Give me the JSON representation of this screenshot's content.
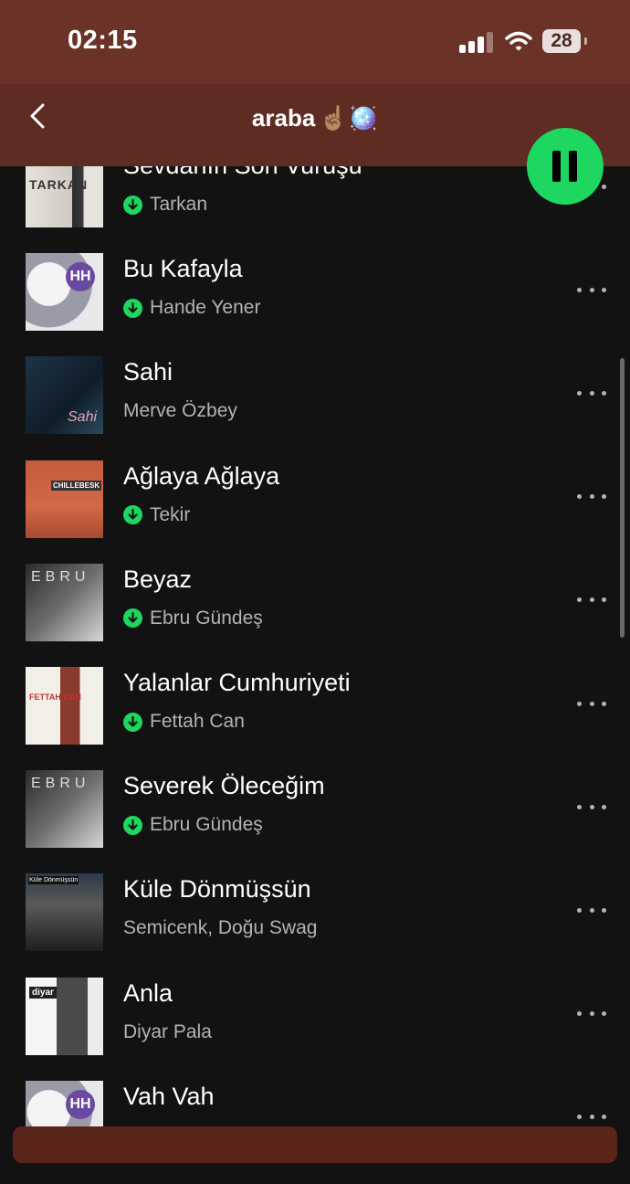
{
  "status": {
    "time": "02:15",
    "battery": "28"
  },
  "header": {
    "title": "araba",
    "emoji": "☝🏽🪩"
  },
  "colors": {
    "accent": "#1ed760",
    "header_bg": "#5e2c22",
    "bg": "#121212"
  },
  "tracks": [
    {
      "title": "Sevdanın Son Vuruşu",
      "artist": "Tarkan",
      "downloaded": true,
      "cover_text": "TARKAN"
    },
    {
      "title": "Bu Kafayla",
      "artist": "Hande Yener",
      "downloaded": true,
      "cover_text": "HH"
    },
    {
      "title": "Sahi",
      "artist": "Merve Özbey",
      "downloaded": false,
      "cover_text": "Sahi"
    },
    {
      "title": "Ağlaya Ağlaya",
      "artist": "Tekir",
      "downloaded": true,
      "cover_text": "CHILLEBESK"
    },
    {
      "title": "Beyaz",
      "artist": "Ebru Gündeş",
      "downloaded": true,
      "cover_text": "EBRU"
    },
    {
      "title": "Yalanlar Cumhuriyeti",
      "artist": "Fettah Can",
      "downloaded": true,
      "cover_text": "FETTAH CAN"
    },
    {
      "title": "Severek Öleceğim",
      "artist": "Ebru Gündeş",
      "downloaded": true,
      "cover_text": "EBRU"
    },
    {
      "title": "Küle Dönmüşsün",
      "artist": "Semicenk, Doğu Swag",
      "downloaded": false,
      "cover_text": "Küle Dönmüşsün"
    },
    {
      "title": "Anla",
      "artist": "Diyar Pala",
      "downloaded": false,
      "cover_text": "diyar"
    },
    {
      "title": "Vah Vah",
      "artist": "",
      "downloaded": false,
      "cover_text": "HH"
    }
  ]
}
